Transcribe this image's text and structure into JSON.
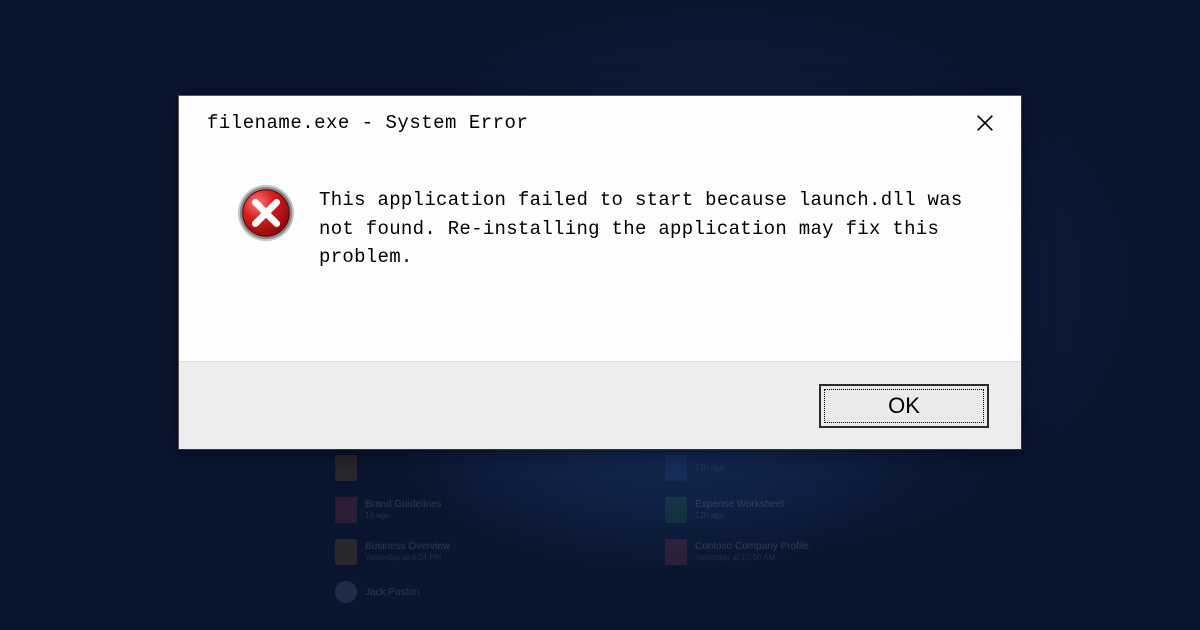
{
  "dialog": {
    "title": "filename.exe - System Error",
    "message": "This application failed to start because launch.dll was not found. Re-installing the application may fix this problem.",
    "ok_label": "OK"
  },
  "desktop": {
    "items_left": [
      {
        "name": "",
        "sub": ""
      },
      {
        "name": "Brand Guidelines",
        "sub": "1d ago"
      },
      {
        "name": "Business Overview",
        "sub": "Yesterday at 4:24 PM"
      }
    ],
    "items_right": [
      {
        "name": "",
        "sub": "12h ago"
      },
      {
        "name": "Expense Worksheet",
        "sub": "12h ago"
      },
      {
        "name": "Contoso Company Profile",
        "sub": "Yesterday at 10:50 AM"
      }
    ],
    "user": "Jack Poston"
  }
}
